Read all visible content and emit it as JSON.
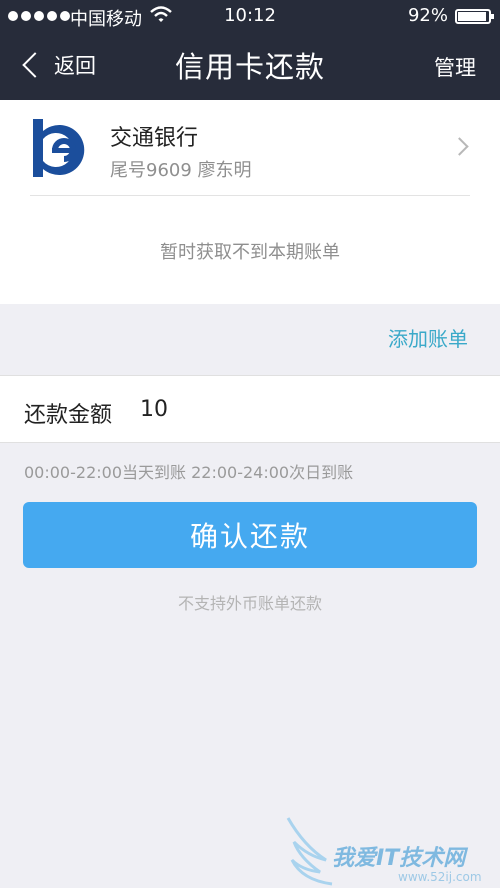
{
  "status_bar": {
    "carrier": "中国移动",
    "time": "10:12",
    "battery_text": "92%",
    "battery_level": 0.92,
    "signal_icon": "signal-dots-icon",
    "wifi_icon": "wifi-icon"
  },
  "nav": {
    "back_label": "返回",
    "title": "信用卡还款",
    "manage_label": "管理",
    "background": "#272c3a"
  },
  "card": {
    "bank_name": "交通银行",
    "card_info": "尾号9609 廖东明",
    "logo_icon": "bank-of-communications-logo",
    "logo_color": "#1b4e9c"
  },
  "bill_status": "暂时获取不到本期账单",
  "add_bill_label": "添加账单",
  "amount": {
    "label": "还款金额",
    "value": "10"
  },
  "arrival_note": "00:00-22:00当天到账  22:00-24:00次日到账",
  "confirm_button": {
    "label": "确认还款",
    "color": "#45a9f0"
  },
  "foreign_note": "不支持外币账单还款",
  "watermark": {
    "text": "我爱IT技术网",
    "url": "www.52ij.com"
  },
  "accent_color": "#3aa9c9"
}
